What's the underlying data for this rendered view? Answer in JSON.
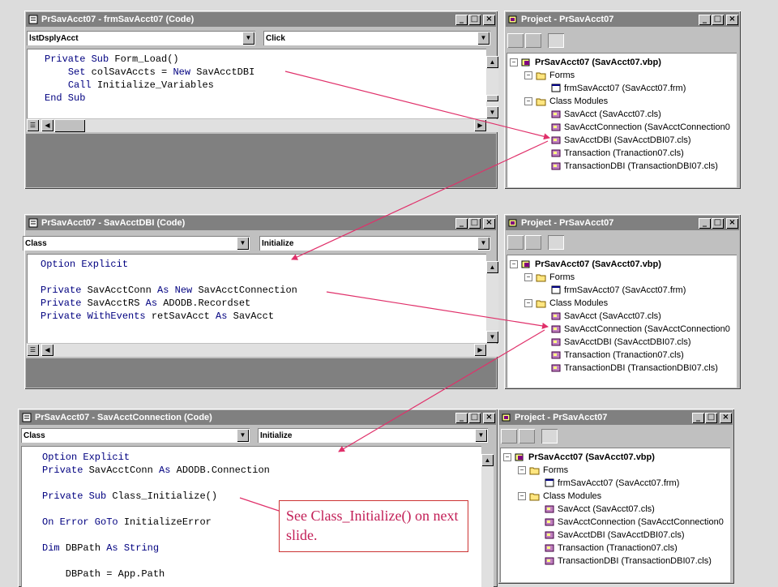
{
  "windows": [
    {
      "title": "PrSavAcct07 - frmSavAcct07 (Code)",
      "object_combo": "lstDsplyAcct",
      "proc_combo": "Click",
      "code_lines": [
        [
          {
            "t": "Private Sub ",
            "k": true
          },
          {
            "t": "Form_Load()"
          }
        ],
        [
          {
            "t": "    "
          },
          {
            "t": "Set ",
            "k": true
          },
          {
            "t": "colSavAccts = "
          },
          {
            "t": "New ",
            "k": true
          },
          {
            "t": "SavAcctDBI"
          }
        ],
        [
          {
            "t": "    "
          },
          {
            "t": "Call ",
            "k": true
          },
          {
            "t": "Initialize_Variables"
          }
        ],
        [
          {
            "t": "End Sub",
            "k": true
          }
        ]
      ]
    },
    {
      "title": "PrSavAcct07 - SavAcctDBI (Code)",
      "object_combo": "Class",
      "proc_combo": "Initialize",
      "code_lines": [
        [
          {
            "t": "Option Explicit",
            "k": true
          }
        ],
        [
          {
            "t": ""
          }
        ],
        [
          {
            "t": "Private ",
            "k": true
          },
          {
            "t": "SavAcctConn "
          },
          {
            "t": "As New ",
            "k": true
          },
          {
            "t": "SavAcctConnection"
          }
        ],
        [
          {
            "t": "Private ",
            "k": true
          },
          {
            "t": "SavAcctRS "
          },
          {
            "t": "As ",
            "k": true
          },
          {
            "t": "ADODB.Recordset"
          }
        ],
        [
          {
            "t": "Private WithEvents ",
            "k": true
          },
          {
            "t": "retSavAcct "
          },
          {
            "t": "As ",
            "k": true
          },
          {
            "t": "SavAcct"
          }
        ]
      ]
    },
    {
      "title": "PrSavAcct07 - SavAcctConnection (Code)",
      "object_combo": "Class",
      "proc_combo": "Initialize",
      "code_lines": [
        [
          {
            "t": "Option Explicit",
            "k": true
          }
        ],
        [
          {
            "t": "Private ",
            "k": true
          },
          {
            "t": "SavAcctConn "
          },
          {
            "t": "As ",
            "k": true
          },
          {
            "t": "ADODB.Connection"
          }
        ],
        [
          {
            "t": ""
          }
        ],
        [
          {
            "t": "Private Sub ",
            "k": true
          },
          {
            "t": "Class_Initialize()"
          }
        ],
        [
          {
            "t": ""
          }
        ],
        [
          {
            "t": "On Error GoTo ",
            "k": true
          },
          {
            "t": "InitializeError"
          }
        ],
        [
          {
            "t": ""
          }
        ],
        [
          {
            "t": "Dim ",
            "k": true
          },
          {
            "t": "DBPath "
          },
          {
            "t": "As String",
            "k": true
          }
        ],
        [
          {
            "t": ""
          }
        ],
        [
          {
            "t": "    DBPath = App.Path"
          }
        ]
      ]
    }
  ],
  "project": {
    "title": "Project - PrSavAcct07",
    "root": "PrSavAcct07 (SavAcct07.vbp)",
    "forms_folder": "Forms",
    "form_item": "frmSavAcct07 (SavAcct07.frm)",
    "class_folder": "Class Modules",
    "classes": [
      "SavAcct (SavAcct07.cls)",
      "SavAcctConnection (SavAcctConnection0",
      "SavAcctDBI (SavAcctDBI07.cls)",
      "Transaction (Tranaction07.cls)",
      "TransactionDBI (TransactionDBI07.cls)"
    ]
  },
  "callout": {
    "text": "See Class_Initialize() on next slide."
  },
  "colors": {
    "arrow": "#e0306a",
    "keyword": "#000080",
    "title_inactive": "#808080"
  }
}
